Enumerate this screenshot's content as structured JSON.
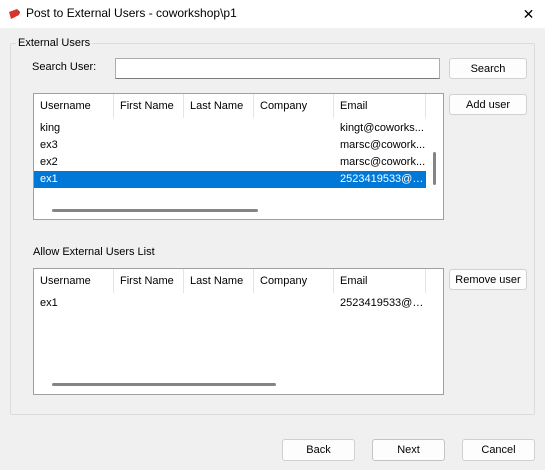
{
  "window": {
    "title": "Post to External Users - coworkshop\\p1",
    "close_glyph": "✕"
  },
  "group": {
    "label": "External Users"
  },
  "search": {
    "label": "Search User:",
    "value": "",
    "button_label": "Search"
  },
  "buttons": {
    "add_user": "Add user",
    "remove_user": "Remove user",
    "back": "Back",
    "next": "Next",
    "cancel": "Cancel"
  },
  "columns": [
    "Username",
    "First Name",
    "Last Name",
    "Company",
    "Email"
  ],
  "users_list": {
    "rows": [
      {
        "username": "king",
        "first_name": "",
        "last_name": "",
        "company": "",
        "email": "kingt@coworks...",
        "selected": false
      },
      {
        "username": "ex3",
        "first_name": "",
        "last_name": "",
        "company": "",
        "email": "marsc@cowork...",
        "selected": false
      },
      {
        "username": "ex2",
        "first_name": "",
        "last_name": "",
        "company": "",
        "email": "marsc@cowork...",
        "selected": false
      },
      {
        "username": "ex1",
        "first_name": "",
        "last_name": "",
        "company": "",
        "email": "2523419533@q...",
        "selected": true
      }
    ]
  },
  "allow_list": {
    "label": "Allow External Users List",
    "rows": [
      {
        "username": "ex1",
        "first_name": "",
        "last_name": "",
        "company": "",
        "email": "2523419533@q..."
      }
    ]
  },
  "colors": {
    "selection": "#0078d7",
    "app_icon": "#d9342b"
  },
  "icons": {
    "app": "app-logo-icon",
    "close": "close-icon"
  }
}
